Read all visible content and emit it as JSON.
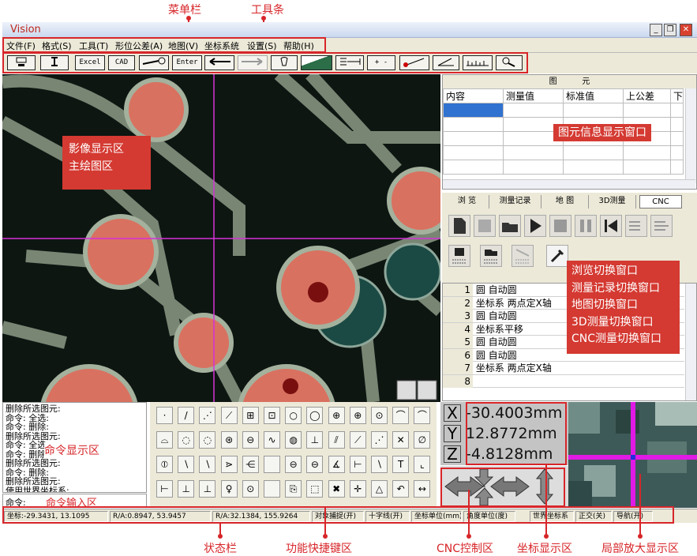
{
  "annotations": {
    "menubar": "菜单栏",
    "toolbar": "工具条",
    "image_area": [
      "影像显示区",
      "主绘图区"
    ],
    "element_info": "图元信息显示窗口",
    "switch_windows": [
      "浏览切换窗口",
      "测量记录切换窗口",
      "地图切换窗口",
      "3D测量切换窗口",
      "CNC测量切换窗口"
    ],
    "command_display": "命令显示区",
    "command_input": "命令输入区",
    "status_bar": "状态栏",
    "function_shortcuts": "功能快捷键区",
    "cnc_control": "CNC控制区",
    "coord_display": "坐标显示区",
    "zoom_display": "局部放大显示区"
  },
  "window": {
    "title": "Vision",
    "buttons": [
      "_",
      "❐",
      "✕"
    ]
  },
  "menu": [
    "文件(F)",
    "格式(S)",
    "工具(T)",
    "形位公差(A)",
    "地图(V)",
    "坐标系统",
    "设置(S)",
    "帮助(H)"
  ],
  "toolbar": {
    "excel": "Excel",
    "cad": "CAD",
    "enter": "Enter",
    "plusminus": "+ -"
  },
  "element_panel": {
    "title": "图          元",
    "columns": [
      "内容",
      "测量值",
      "标准值",
      "上公差",
      "下"
    ]
  },
  "tabs": [
    "浏 览",
    "测量记录",
    "地 图",
    "3D测量",
    "CNC"
  ],
  "records": [
    {
      "n": "1",
      "text": "圆   自动圆"
    },
    {
      "n": "2",
      "text": "坐标系  两点定X轴"
    },
    {
      "n": "3",
      "text": "圆   自动圆"
    },
    {
      "n": "4",
      "text": "坐标系平移"
    },
    {
      "n": "5",
      "text": "圆   自动圆"
    },
    {
      "n": "6",
      "text": "圆   自动圆"
    },
    {
      "n": "7",
      "text": "坐标系  两点定X轴"
    },
    {
      "n": "8",
      "text": ""
    }
  ],
  "commands": [
    "删除所选图元:",
    "命令: 全选:",
    "命令: 删除:",
    "删除所选图元:",
    "命令: 全选",
    "命令: 删除:",
    "删除所选图元:",
    "命令: 删除:",
    "删除所选图元:",
    "使用世界坐标系:"
  ],
  "command_prompt": "命令:",
  "coords": {
    "x_label": "X",
    "y_label": "Y",
    "z_label": "Z",
    "x": "-30.4003mm",
    "y": "12.8772mm",
    "z": "-4.8128mm"
  },
  "status": [
    "坐标:-29.3431, 13.1095",
    "R/A:0.8947, 53.9457",
    "R/A:32.1384, 155.9264",
    "对象捕捉(开)",
    "十字线(开)",
    "坐标单位(mm)",
    "角度单位(度)",
    "世界坐标系",
    "正交(关)",
    "导航(开)"
  ],
  "colors": {
    "accent": "#d7262a",
    "callout": "#d43a32",
    "crosshair": "#d531d8",
    "panel": "#ece9d8"
  }
}
